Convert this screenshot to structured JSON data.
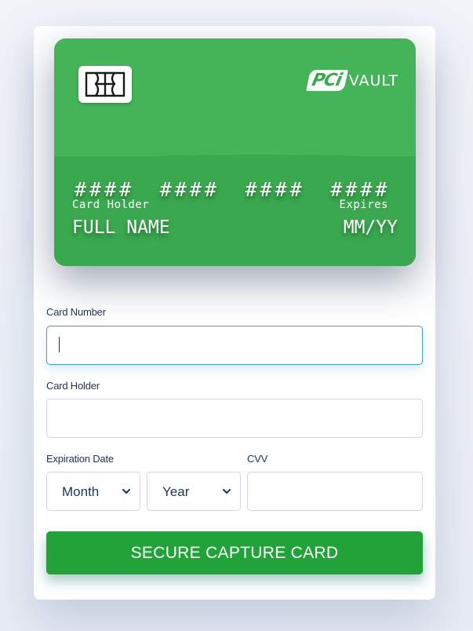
{
  "card_preview": {
    "brand": {
      "pci": "PCi",
      "vault": "VAULT"
    },
    "number_groups": [
      "####",
      "####",
      "####",
      "####"
    ],
    "holder_label": "Card Holder",
    "holder_value": "FULL NAME",
    "expires_label": "Expires",
    "expires_value": "MM/YY"
  },
  "form": {
    "card_number": {
      "label": "Card Number",
      "value": ""
    },
    "card_holder": {
      "label": "Card Holder",
      "value": ""
    },
    "expiration": {
      "label": "Expiration Date",
      "month_value": "Month",
      "year_value": "Year"
    },
    "cvv": {
      "label": "CVV",
      "value": ""
    },
    "submit_label": "SECURE CAPTURE CARD"
  },
  "colors": {
    "brand_green": "#21a33a",
    "card_green": "#3aa84e",
    "focus_border": "#3d9cd6",
    "label_text": "#1c3553"
  }
}
